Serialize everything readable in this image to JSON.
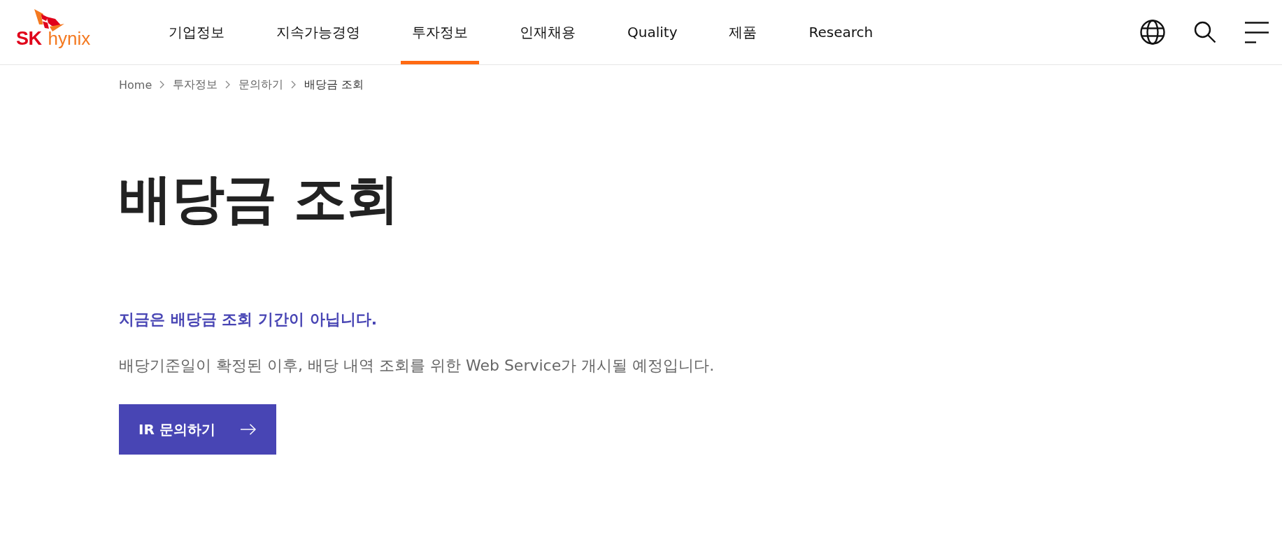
{
  "logo": {
    "brand": "SK",
    "product": "hynix"
  },
  "nav": {
    "items": [
      {
        "label": "기업정보",
        "selected": false
      },
      {
        "label": "지속가능경영",
        "selected": false
      },
      {
        "label": "투자정보",
        "selected": true
      },
      {
        "label": "인재채용",
        "selected": false
      },
      {
        "label": "Quality",
        "selected": false
      },
      {
        "label": "제품",
        "selected": false
      },
      {
        "label": "Research",
        "selected": false
      }
    ]
  },
  "breadcrumb": [
    {
      "label": "Home",
      "current": false
    },
    {
      "label": "투자정보",
      "current": false
    },
    {
      "label": "문의하기",
      "current": false
    },
    {
      "label": "배당금 조회",
      "current": true
    }
  ],
  "page": {
    "title": "배당금 조회",
    "notice": "지금은 배당금 조회 기간이 아닙니다.",
    "description": "배당기준일이 확정된 이후, 배당 내역 조회를 위한 Web Service가 개시될 예정입니다.",
    "button": {
      "label": "IR 문의하기"
    }
  }
}
